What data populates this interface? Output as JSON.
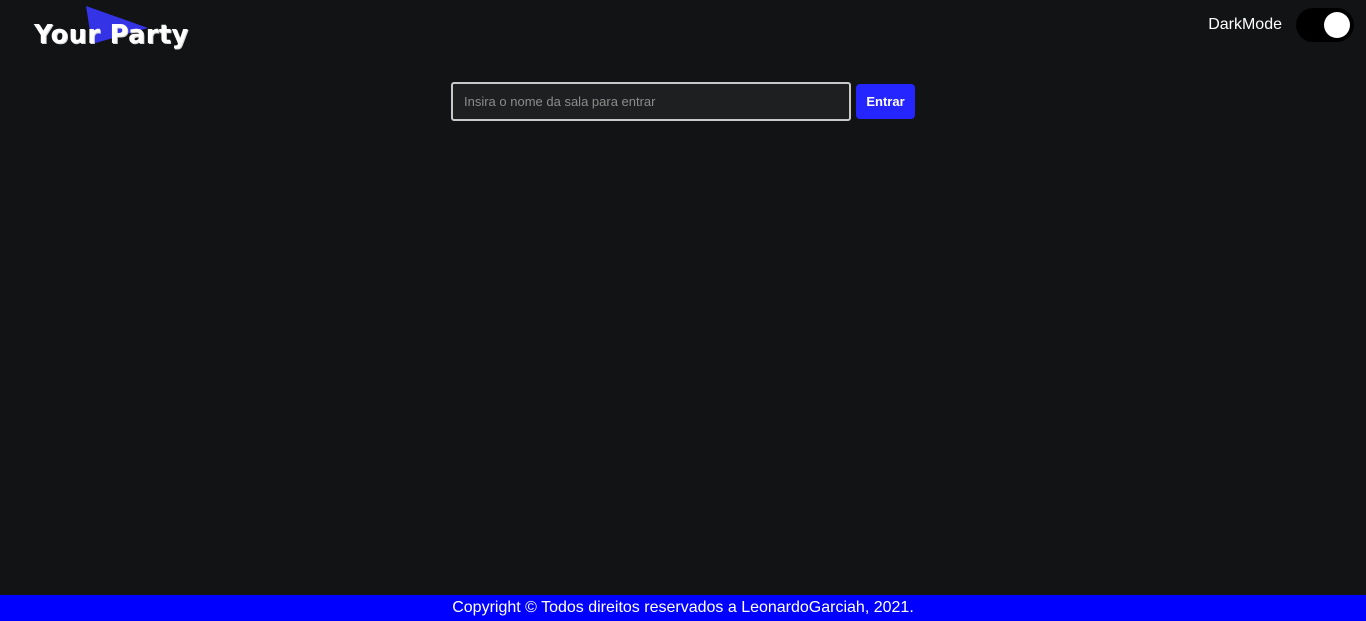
{
  "header": {
    "logo_text": "Your Party",
    "darkmode_label": "DarkMode",
    "darkmode_enabled": true
  },
  "room_form": {
    "input_placeholder": "Insira o nome da sala para entrar",
    "input_value": "",
    "enter_label": "Entrar"
  },
  "footer": {
    "copyright": "Copyright © Todos direitos reservados a LeonardoGarciah, 2021."
  },
  "colors": {
    "background": "#121315",
    "accent": "#2525ff",
    "footer": "#0000ff",
    "logo_triangle": "#3434e6"
  }
}
